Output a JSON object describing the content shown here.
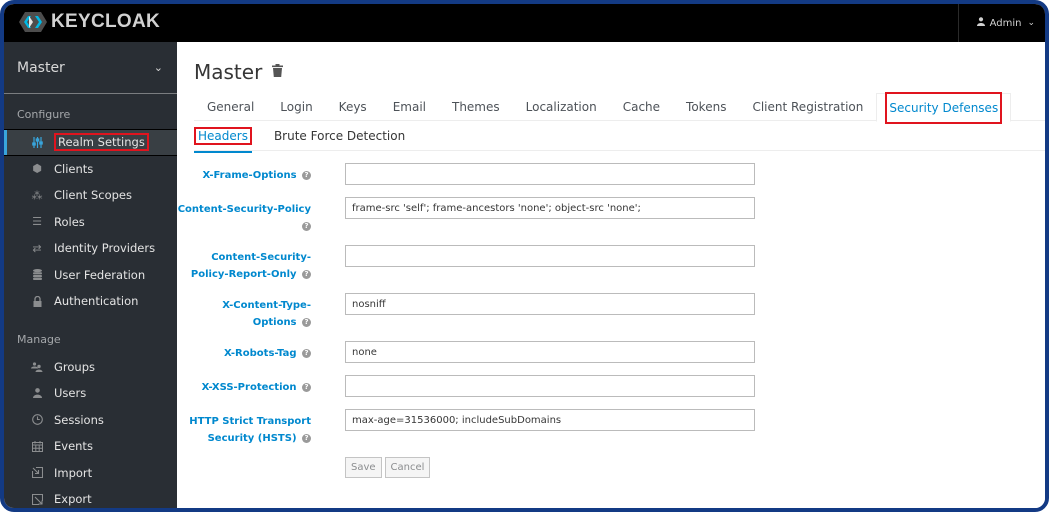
{
  "app": {
    "brand": "KEYCLOAK",
    "user_menu": {
      "label": "Admin",
      "icon": "user-icon"
    }
  },
  "sidebar": {
    "realm": "Master",
    "sections": [
      {
        "title": "Configure",
        "items": [
          {
            "label": "Realm Settings",
            "icon": "sliders-icon",
            "active": true
          },
          {
            "label": "Clients",
            "icon": "cube-icon"
          },
          {
            "label": "Client Scopes",
            "icon": "cubes-icon"
          },
          {
            "label": "Roles",
            "icon": "list-icon"
          },
          {
            "label": "Identity Providers",
            "icon": "exchange-icon"
          },
          {
            "label": "User Federation",
            "icon": "database-icon"
          },
          {
            "label": "Authentication",
            "icon": "lock-icon"
          }
        ]
      },
      {
        "title": "Manage",
        "items": [
          {
            "label": "Groups",
            "icon": "users-icon"
          },
          {
            "label": "Users",
            "icon": "user-icon"
          },
          {
            "label": "Sessions",
            "icon": "clock-icon"
          },
          {
            "label": "Events",
            "icon": "calendar-icon"
          },
          {
            "label": "Import",
            "icon": "import-icon"
          },
          {
            "label": "Export",
            "icon": "export-icon"
          }
        ]
      }
    ]
  },
  "main": {
    "title": "Master",
    "tabs": [
      {
        "label": "General"
      },
      {
        "label": "Login"
      },
      {
        "label": "Keys"
      },
      {
        "label": "Email"
      },
      {
        "label": "Themes"
      },
      {
        "label": "Localization"
      },
      {
        "label": "Cache"
      },
      {
        "label": "Tokens"
      },
      {
        "label": "Client Registration"
      },
      {
        "label": "Security Defenses",
        "active": true
      }
    ],
    "subtabs": [
      {
        "label": "Headers",
        "active": true
      },
      {
        "label": "Brute Force Detection"
      }
    ],
    "form": {
      "fields": [
        {
          "label_lines": [
            "X-Frame-Options"
          ],
          "value": ""
        },
        {
          "label_lines": [
            "Content-Security-Policy"
          ],
          "value": "frame-src 'self'; frame-ancestors 'none'; object-src 'none';",
          "help_on_own_line": true
        },
        {
          "label_lines": [
            "Content-Security-",
            "Policy-Report-Only"
          ],
          "value": ""
        },
        {
          "label_lines": [
            "X-Content-Type-",
            "Options"
          ],
          "value": "nosniff"
        },
        {
          "label_lines": [
            "X-Robots-Tag"
          ],
          "value": "none"
        },
        {
          "label_lines": [
            "X-XSS-Protection"
          ],
          "value": ""
        },
        {
          "label_lines": [
            "HTTP Strict Transport",
            "Security (HSTS)"
          ],
          "value": "max-age=31536000; includeSubDomains"
        }
      ],
      "save_label": "Save",
      "cancel_label": "Cancel"
    }
  },
  "colors": {
    "accent": "#0088ce",
    "sidebar_bg": "#292e34",
    "topbar_bg": "#000000",
    "highlight": "#e0141e",
    "frame": "#133a84"
  }
}
